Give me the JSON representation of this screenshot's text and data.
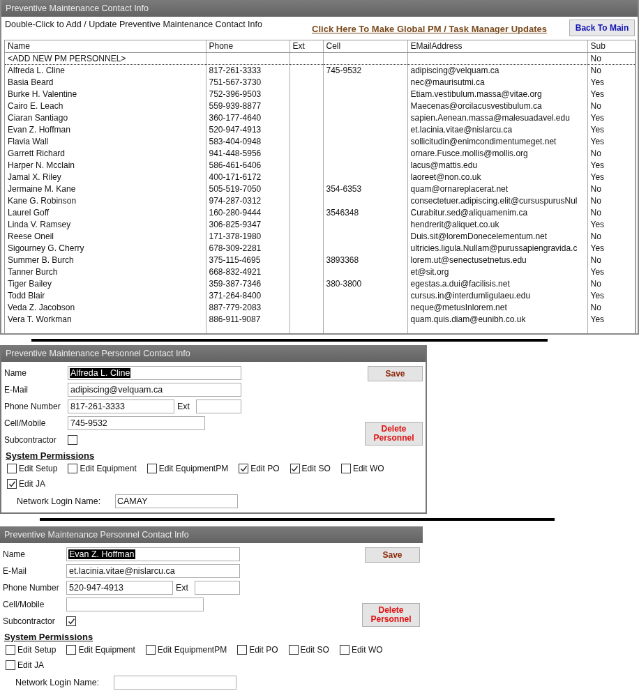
{
  "window": {
    "title": "Preventive Maintenance Contact Info"
  },
  "instructions": "Double-Click to Add / Update Preventive Maintenance Contact Info",
  "global_update_link": "Click Here To Make Global PM / Task Manager Updates",
  "back_button": "Back To Main",
  "table": {
    "columns": [
      "Name",
      "Phone",
      "Ext",
      "Cell",
      "EMailAddress",
      "Sub"
    ],
    "rows": [
      {
        "name": "<ADD NEW PM PERSONNEL>",
        "sub": "No",
        "kind": "new"
      },
      {
        "name": "Alfreda L. Cline",
        "phone": "817-261-3333",
        "cell": "745-9532",
        "email": "adipiscing@velquam.ca",
        "sub": "No"
      },
      {
        "name": "Basia Beard",
        "phone": "751-567-3730",
        "email": "nec@maurisutmi.ca",
        "sub": "Yes"
      },
      {
        "name": "Burke H. Valentine",
        "phone": "752-396-9503",
        "email": "Etiam.vestibulum.massa@vitae.org",
        "sub": "Yes"
      },
      {
        "name": "Cairo E. Leach",
        "phone": "559-939-8877",
        "email": "Maecenas@orcilacusvestibulum.ca",
        "sub": "No"
      },
      {
        "name": "Ciaran Santiago",
        "phone": "360-177-4640",
        "email": "sapien.Aenean.massa@malesuadavel.edu",
        "sub": "Yes"
      },
      {
        "name": "Evan Z. Hoffman",
        "phone": "520-947-4913",
        "email": "et.lacinia.vitae@nislarcu.ca",
        "sub": "Yes"
      },
      {
        "name": "Flavia Wall",
        "phone": "583-404-0948",
        "email": "sollicitudin@enimcondimentumeget.net",
        "sub": "Yes"
      },
      {
        "name": "Garrett Richard",
        "phone": "941-448-5956",
        "email": "ornare.Fusce.mollis@mollis.org",
        "sub": "No"
      },
      {
        "name": "Harper N. Mcclain",
        "phone": "586-461-6406",
        "email": "lacus@mattis.edu",
        "sub": "Yes"
      },
      {
        "name": "Jamal X. Riley",
        "phone": "400-171-6172",
        "email": "laoreet@non.co.uk",
        "sub": "Yes"
      },
      {
        "name": "Jermaine M. Kane",
        "phone": "505-519-7050",
        "cell": "354-6353",
        "email": "quam@ornareplacerat.net",
        "sub": "No"
      },
      {
        "name": "Kane G. Robinson",
        "phone": "974-287-0312",
        "email": "consectetuer.adipiscing.elit@cursuspurusNul",
        "sub": "No"
      },
      {
        "name": "Laurel Goff",
        "phone": "160-280-9444",
        "cell": "3546348",
        "email": "Curabitur.sed@aliquamenim.ca",
        "sub": "No"
      },
      {
        "name": "Linda V. Ramsey",
        "phone": "306-825-9347",
        "email": "hendrerit@aliquet.co.uk",
        "sub": "Yes"
      },
      {
        "name": "Reese Oneil",
        "phone": "171-378-1980",
        "email": "Duis.sit@loremDonecelementum.net",
        "sub": "No"
      },
      {
        "name": "Sigourney G. Cherry",
        "phone": "678-309-2281",
        "email": "ultricies.ligula.Nullam@purussapiengravida.c",
        "sub": "Yes"
      },
      {
        "name": "Summer B. Burch",
        "phone": "375-115-4695",
        "cell": "3893368",
        "email": "lorem.ut@senectusetnetus.edu",
        "sub": "No"
      },
      {
        "name": "Tanner Burch",
        "phone": "668-832-4921",
        "email": "et@sit.org",
        "sub": "Yes"
      },
      {
        "name": "Tiger Bailey",
        "phone": "359-387-7346",
        "cell": "380-3800",
        "email": "egestas.a.dui@facilisis.net",
        "sub": "No"
      },
      {
        "name": "Todd Blair",
        "phone": "371-264-8400",
        "email": "cursus.in@interdumligulaeu.edu",
        "sub": "Yes"
      },
      {
        "name": "Veda Z. Jacobson",
        "phone": "887-779-2083",
        "email": "neque@metusInlorem.net",
        "sub": "No"
      },
      {
        "name": "Vera T. Workman",
        "phone": "886-911-9087",
        "email": "quam.quis.diam@eunibh.co.uk",
        "sub": "Yes"
      }
    ]
  },
  "forms": [
    {
      "title": "Preventive Maintenance Personnel Contact Info",
      "framed": true,
      "fields": [
        {
          "kind": "wide",
          "label": "Name",
          "value": "Alfreda L. Cline",
          "text_selected": true
        },
        {
          "kind": "wide",
          "label": "E-Mail",
          "value": "adipiscing@velquam.ca",
          "text_selected": false
        },
        {
          "kind": "phone",
          "label": "Phone Number",
          "value": "817-261-3333",
          "ext_label": "Ext",
          "text_selected": false
        },
        {
          "kind": "medium",
          "label": "Cell/Mobile",
          "value": "745-9532",
          "text_selected": false
        }
      ],
      "subcontractor": {
        "label": "Subcontractor",
        "checked": false
      },
      "save_button": "Save",
      "delete_button": "Delete Personnel",
      "permissions_heading": "System Permissions",
      "permissions": [
        {
          "label": "Edit Setup",
          "checked": false
        },
        {
          "label": "Edit Equipment",
          "checked": false
        },
        {
          "label": "Edit EquipmentPM",
          "checked": false
        },
        {
          "label": "Edit PO",
          "checked": true
        },
        {
          "label": "Edit SO",
          "checked": true
        },
        {
          "label": "Edit WO",
          "checked": false
        },
        {
          "label": "Edit JA",
          "checked": true
        }
      ],
      "network_login": {
        "label": "Network Login Name:",
        "value": "CAMAY"
      }
    },
    {
      "title": "Preventive Maintenance Personnel Contact Info",
      "framed": false,
      "fields": [
        {
          "kind": "wide",
          "label": "Name",
          "value": "Evan Z. Hoffman",
          "text_selected": true
        },
        {
          "kind": "wide",
          "label": "E-Mail",
          "value": "et.lacinia.vitae@nislarcu.ca",
          "text_selected": false
        },
        {
          "kind": "phone",
          "label": "Phone Number",
          "value": "520-947-4913",
          "ext_label": "Ext",
          "text_selected": false
        },
        {
          "kind": "medium",
          "label": "Cell/Mobile"
        }
      ],
      "subcontractor": {
        "label": "Subcontractor",
        "checked": true
      },
      "save_button": "Save",
      "delete_button": "Delete Personnel",
      "permissions_heading": "System Permissions",
      "permissions": [
        {
          "label": "Edit Setup",
          "checked": false
        },
        {
          "label": "Edit Equipment",
          "checked": false
        },
        {
          "label": "Edit EquipmentPM",
          "checked": false
        },
        {
          "label": "Edit PO",
          "checked": false
        },
        {
          "label": "Edit SO",
          "checked": false
        },
        {
          "label": "Edit WO",
          "checked": false
        },
        {
          "label": "Edit JA",
          "checked": false
        }
      ],
      "network_login": {
        "label": "Network Login Name:"
      }
    }
  ]
}
